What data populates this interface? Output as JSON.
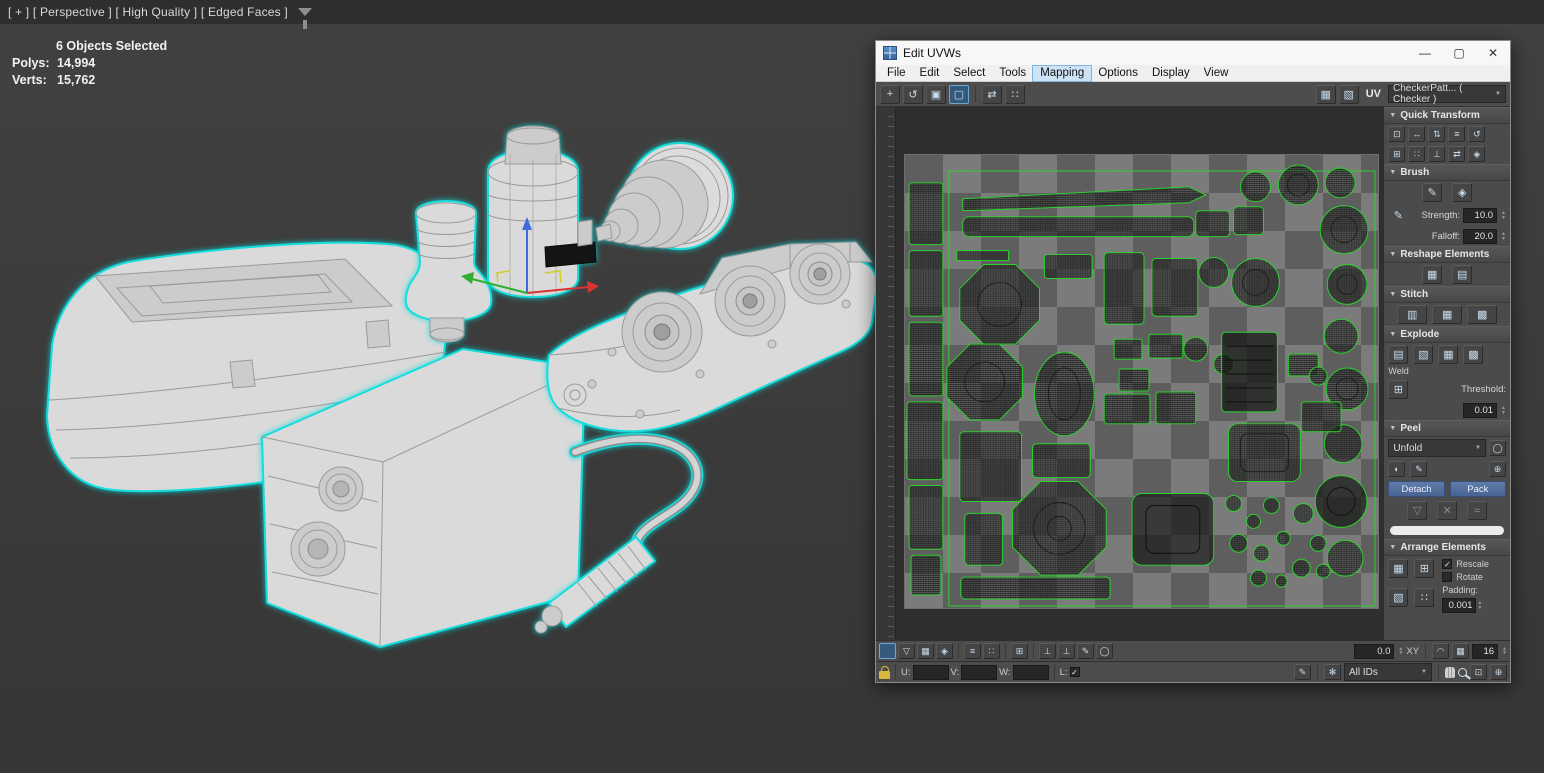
{
  "viewport": {
    "label": "[ + ] [ Perspective ] [ High Quality ] [ Edged Faces ]",
    "stats": {
      "selected": "6 Objects Selected",
      "polys_label": "Polys:",
      "polys_value": "14,994",
      "verts_label": "Verts:",
      "verts_value": "15,762"
    }
  },
  "window": {
    "title": "Edit UVWs",
    "menu": {
      "file": "File",
      "edit": "Edit",
      "select": "Select",
      "tools": "Tools",
      "mapping": "Mapping",
      "options": "Options",
      "display": "Display",
      "view": "View"
    },
    "toolbar": {
      "uv_label": "UV",
      "texture": "CheckerPatt... ( Checker )"
    },
    "panel": {
      "quick_transform_title": "Quick Transform",
      "brush_title": "Brush",
      "strength_label": "Strength:",
      "strength_value": "10.0",
      "falloff_label": "Falloff:",
      "falloff_value": "20.0",
      "reshape_title": "Reshape Elements",
      "stitch_title": "Stitch",
      "explode_title": "Explode",
      "weld_label": "Weld",
      "threshold_label": "Threshold:",
      "threshold_value": "0.01",
      "peel_title": "Peel",
      "unfold_label": "Unfold",
      "detach_label": "Detach",
      "pack_label": "Pack",
      "arrange_title": "Arrange Elements",
      "rescale_label": "Rescale",
      "rotate_label": "Rotate",
      "padding_label": "Padding:",
      "padding_value": "0.001"
    },
    "statusbar": {
      "rotate_value": "0.0",
      "xy_label": "XY",
      "grid_value": "16",
      "u_label": "U:",
      "v_label": "V:",
      "w_label": "W:",
      "l_label": "L:",
      "ids_filter": "All IDs"
    }
  },
  "colors": {
    "selection_outline": "#17dcdc",
    "uv_wire_green": "#2dd22d",
    "accent_blue": "#486392"
  },
  "icons": {
    "minimize": "—",
    "maximize": "▢",
    "close": "✕",
    "dropdown": "▼",
    "collapse": "▼",
    "move": "+",
    "rotate": "↺",
    "scale": "▣",
    "square": "▢",
    "grid": "▦",
    "mirror": "⇄",
    "updown": "⇅",
    "leftright": "↔",
    "diamond": "◈",
    "circle": "◯",
    "dot": "●",
    "half": "◐",
    "tri_down": "▽",
    "tri_up": "▲",
    "pencil": "✎",
    "star": "✻",
    "perp": "⊥",
    "angle": "∠",
    "arc": "◠",
    "boxplus": "⊞",
    "boxdot": "⊡",
    "vgrid": "▥",
    "hgrid": "▤",
    "dgrid": "▧",
    "dense": "▩",
    "check": "✓",
    "lines": "≡",
    "dots": "∷",
    "wave": "≈",
    "oplus": "⊕"
  }
}
